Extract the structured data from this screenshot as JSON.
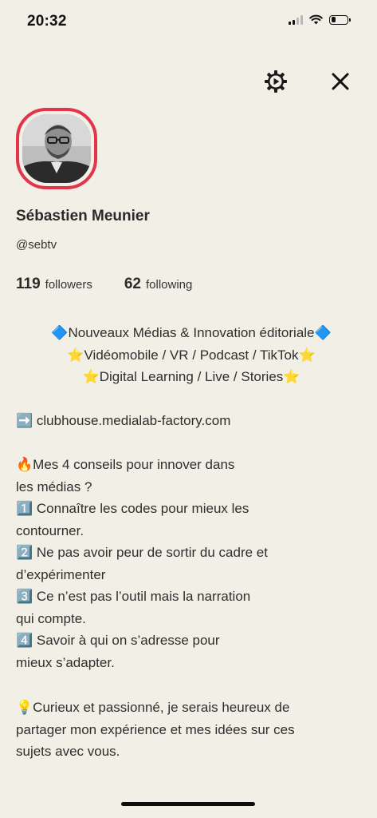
{
  "status_bar": {
    "time": "20:32",
    "battery_level": 0.25
  },
  "top_actions": {
    "settings_icon": "gear-icon",
    "close_icon": "close-icon"
  },
  "profile": {
    "name": "Sébastien Meunier",
    "handle": "@sebtv",
    "followers_count": "119",
    "followers_label": "followers",
    "following_count": "62",
    "following_label": "following"
  },
  "bio": {
    "headline": [
      "🔷Nouveaux Médias & Innovation éditoriale🔷",
      "⭐️Vidéomobile / VR / Podcast / TikTok⭐️",
      "⭐️Digital Learning / Live / Stories⭐️"
    ],
    "link_line": "➡️ clubhouse.medialab-factory.com",
    "tips": [
      "🔥Mes 4 conseils pour innover dans",
      "les médias ?",
      "1️⃣ Connaître les codes pour mieux les",
      "contourner.",
      "2️⃣ Ne pas avoir peur de sortir du cadre et",
      "d’expérimenter",
      "3️⃣ Ce n’est pas l’outil mais la narration",
      "qui compte.",
      "4️⃣ Savoir à qui on s’adresse pour",
      "mieux s’adapter."
    ],
    "closing": [
      "💡Curieux et passionné, je serais heureux de",
      "partager mon expérience et mes idées sur ces",
      "sujets avec vous."
    ]
  },
  "colors": {
    "background": "#f1efe6",
    "avatar_ring": "#e2344a",
    "text": "#2c2c2c"
  }
}
